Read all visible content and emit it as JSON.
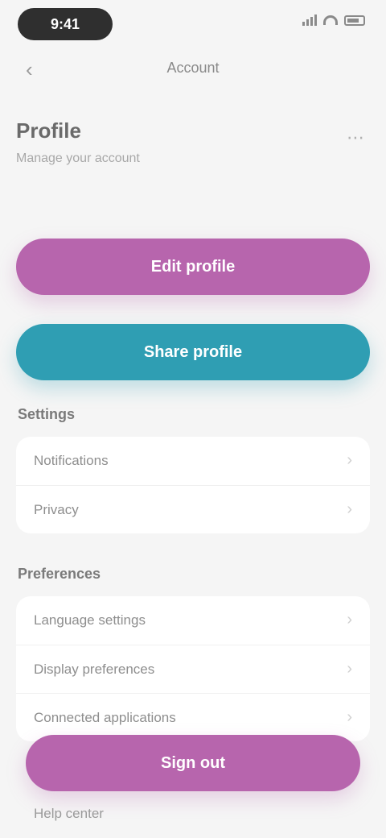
{
  "status_bar": {
    "time": "9:41"
  },
  "nav": {
    "title": "Account"
  },
  "header": {
    "title": "Profile",
    "subtitle": "Manage your account"
  },
  "buttons": {
    "primary_label": "Edit profile",
    "secondary_label": "Share profile"
  },
  "sections": [
    {
      "title": "Settings",
      "items": [
        "Notifications",
        "Privacy"
      ]
    },
    {
      "title": "Preferences",
      "items": [
        "Language settings",
        "Display preferences",
        "Connected applications"
      ]
    }
  ],
  "actions": {
    "danger_label": "Sign out",
    "footer_link": "Help center"
  },
  "colors": {
    "primary": "#b765ad",
    "secondary": "#2f9eb3",
    "background": "#f5f5f5"
  }
}
